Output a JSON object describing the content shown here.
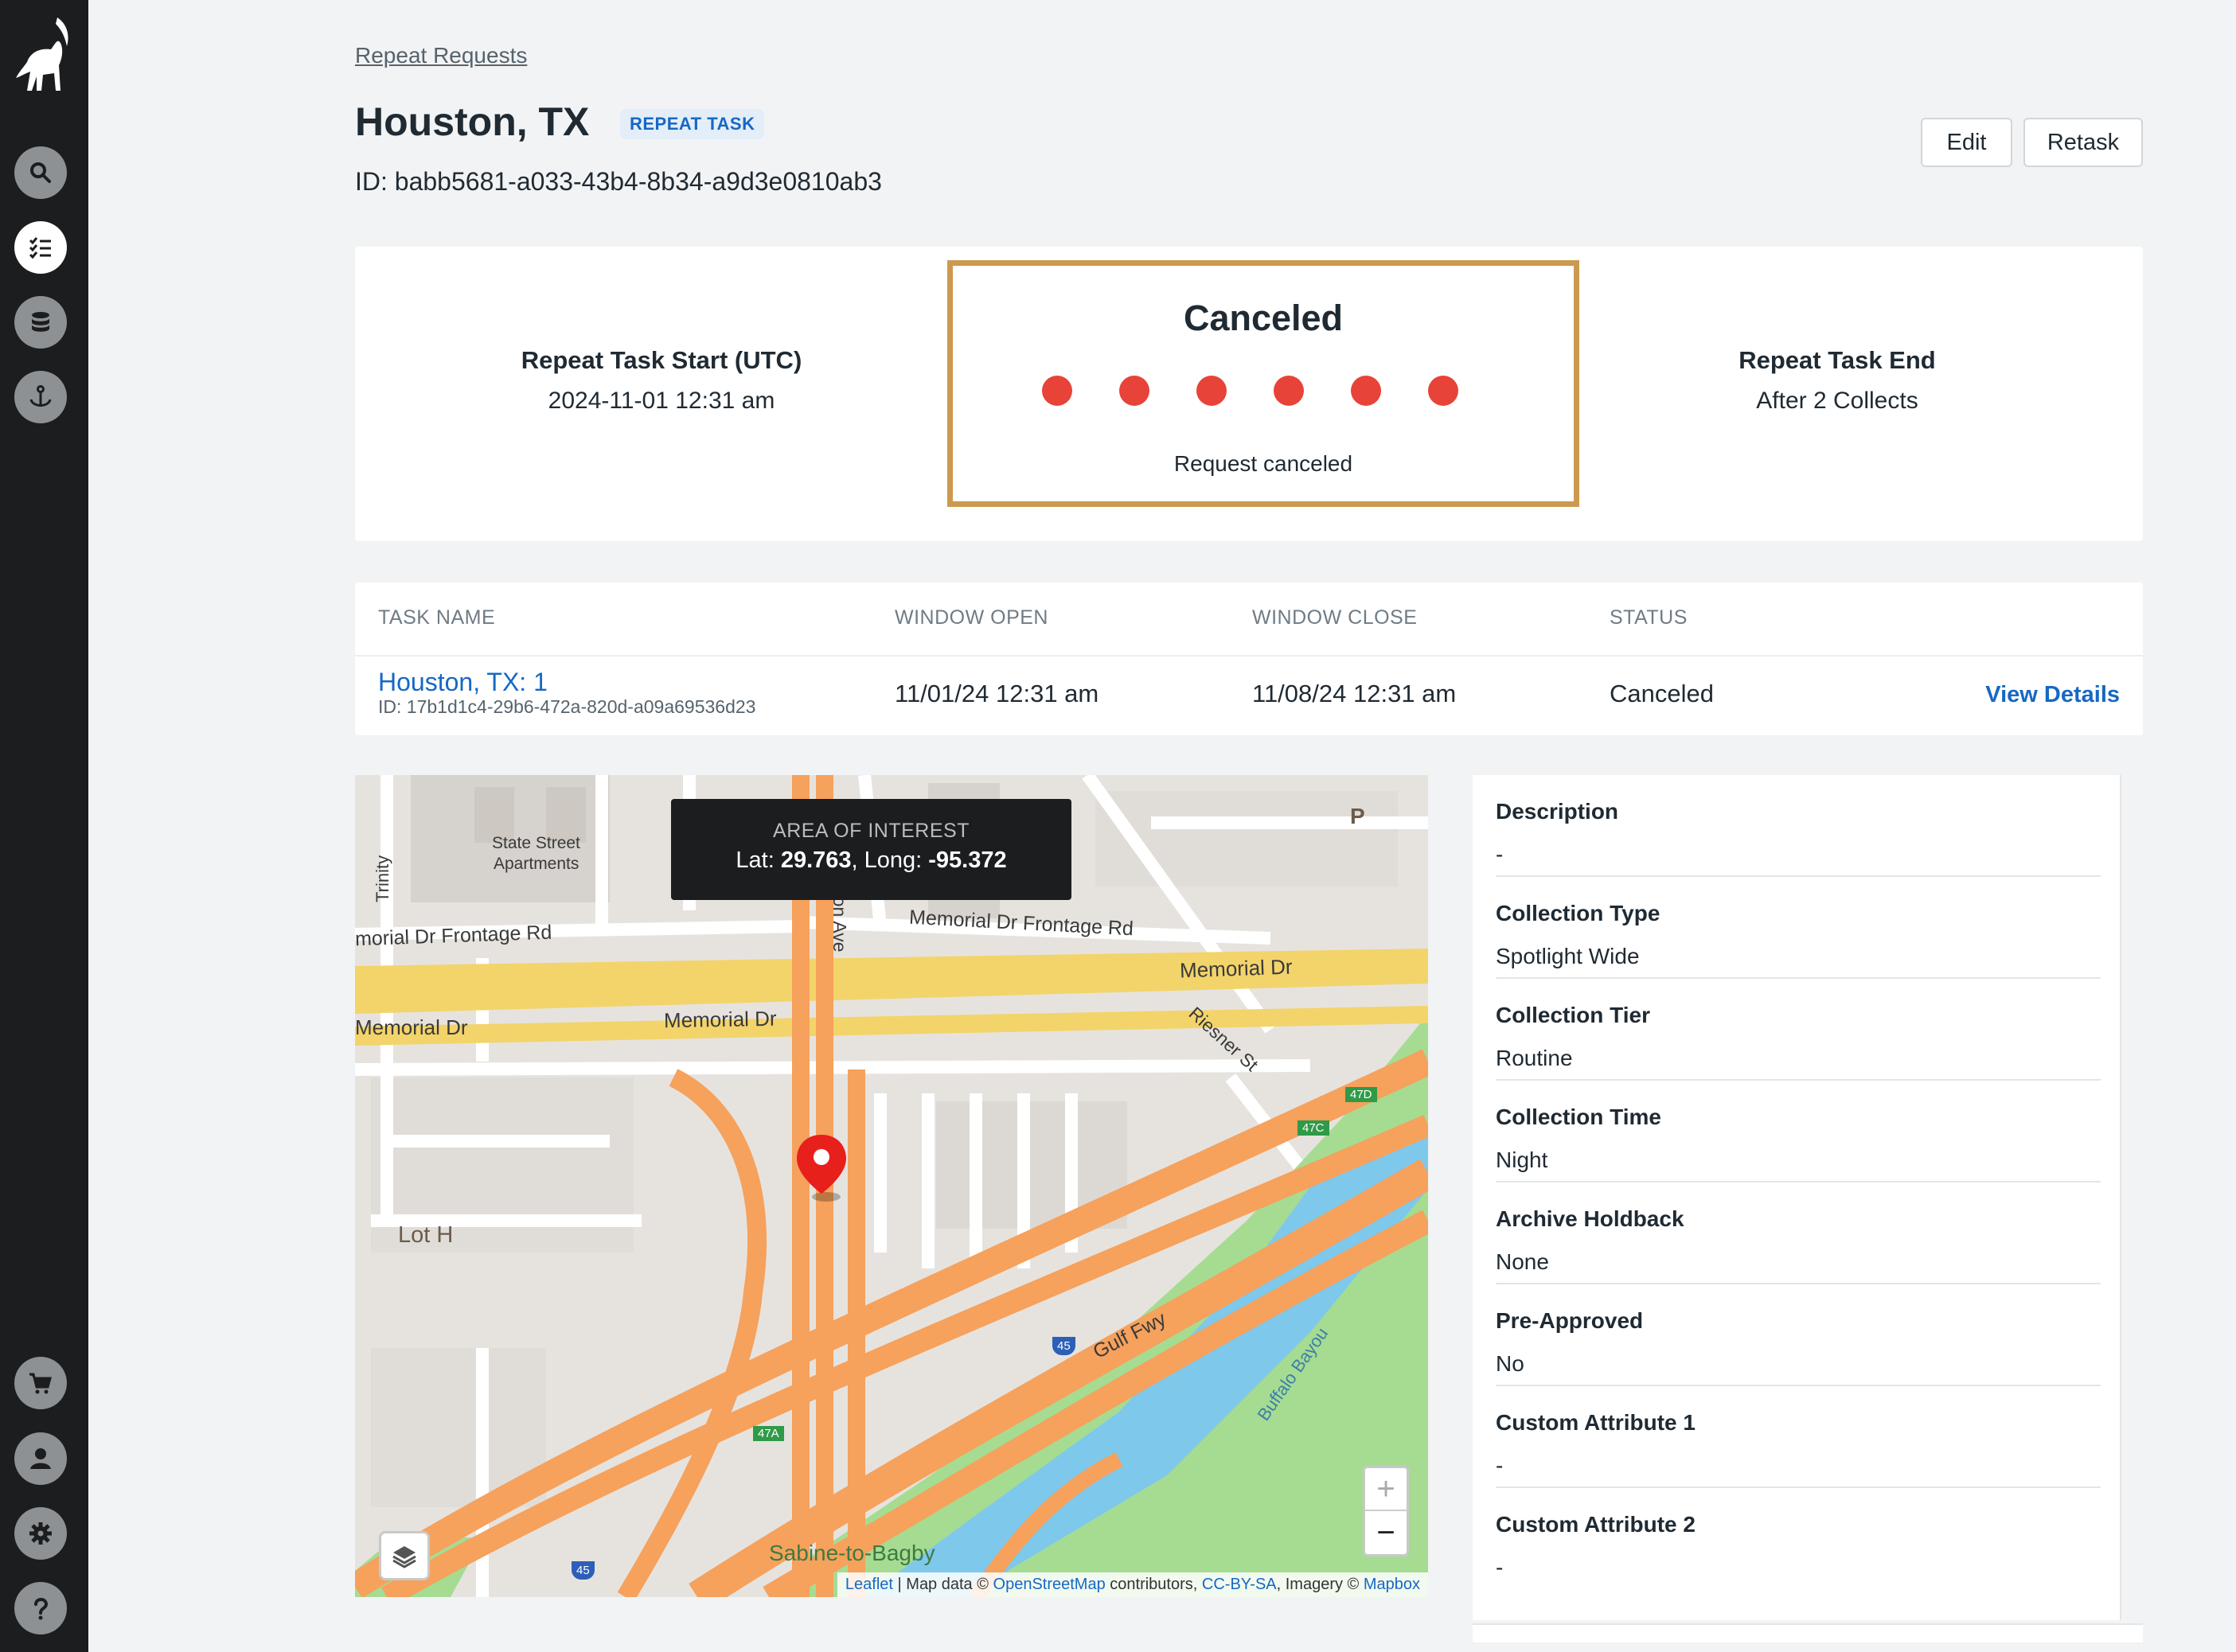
{
  "sidebar": {
    "logo": "ibex-logo",
    "items": [
      {
        "name": "search",
        "icon": "search-icon",
        "active": false
      },
      {
        "name": "tasks",
        "icon": "checklist-icon",
        "active": true
      },
      {
        "name": "data",
        "icon": "database-icon",
        "active": false
      },
      {
        "name": "anchor",
        "icon": "anchor-icon",
        "active": false
      }
    ],
    "bottom_items": [
      {
        "name": "cart",
        "icon": "cart-icon"
      },
      {
        "name": "account",
        "icon": "user-icon"
      },
      {
        "name": "settings",
        "icon": "gear-icon"
      },
      {
        "name": "help",
        "icon": "help-icon"
      }
    ]
  },
  "header": {
    "breadcrumb": "Repeat Requests",
    "title": "Houston, TX",
    "badge": "REPEAT TASK",
    "id_text": "ID: babb5681-a033-43b4-8b34-a9d3e0810ab3",
    "edit_label": "Edit",
    "retask_label": "Retask"
  },
  "status_card": {
    "start_label": "Repeat Task Start (UTC)",
    "start_value": "2024-11-01 12:31 am",
    "status_title": "Canceled",
    "status_sub": "Request canceled",
    "dot_count": 6,
    "dot_color": "#e84338",
    "end_label": "Repeat Task End",
    "end_value": "After 2 Collects"
  },
  "task_table": {
    "headers": [
      "TASK NAME",
      "WINDOW OPEN",
      "WINDOW CLOSE",
      "STATUS"
    ],
    "rows": [
      {
        "name": "Houston, TX: 1",
        "id": "ID: 17b1d1c4-29b6-472a-820d-a09a69536d23",
        "window_open": "11/01/24 12:31 am",
        "window_close": "11/08/24 12:31 am",
        "status": "Canceled",
        "action": "View Details"
      }
    ]
  },
  "map": {
    "aoi_title": "AREA OF INTEREST",
    "lat_label": "Lat: ",
    "lat": "29.763",
    "sep": ", Long: ",
    "long": "-95.372",
    "labels": {
      "state_street": "State Street",
      "apartments": "Apartments",
      "trinity": "Trinity",
      "frontage_left": "morial Dr Frontage Rd",
      "frontage_right": "Memorial Dr Frontage Rd",
      "houston_ave": "uston Ave",
      "memorial_1": "Memorial Dr",
      "memorial_2": "Memorial Dr",
      "memorial_3": "Memorial Dr",
      "riesner": "Riesner St",
      "lot_h": "Lot H",
      "gulf_fwy": "Gulf Fwy",
      "buffalo_bayou": "Buffalo Bayou",
      "sabine": "Sabine-to-Bagby",
      "exit_47d": "47D",
      "exit_47c": "47C",
      "exit_47a": "47A",
      "i45": "45",
      "parking": "P"
    },
    "zoom_in": "+",
    "zoom_out": "−",
    "attribution": {
      "leaflet": "Leaflet",
      "mid": " | Map data © ",
      "osm": "OpenStreetMap",
      "contrib": " contributors, ",
      "license": "CC-BY-SA",
      "imagery": ", Imagery © ",
      "mapbox": "Mapbox"
    }
  },
  "details": [
    {
      "label": "Description",
      "value": "-"
    },
    {
      "label": "Collection Type",
      "value": "Spotlight Wide"
    },
    {
      "label": "Collection Tier",
      "value": "Routine"
    },
    {
      "label": "Collection Time",
      "value": "Night"
    },
    {
      "label": "Archive Holdback",
      "value": "None"
    },
    {
      "label": "Pre-Approved",
      "value": "No"
    },
    {
      "label": "Custom Attribute 1",
      "value": "-"
    },
    {
      "label": "Custom Attribute 2",
      "value": "-"
    }
  ]
}
